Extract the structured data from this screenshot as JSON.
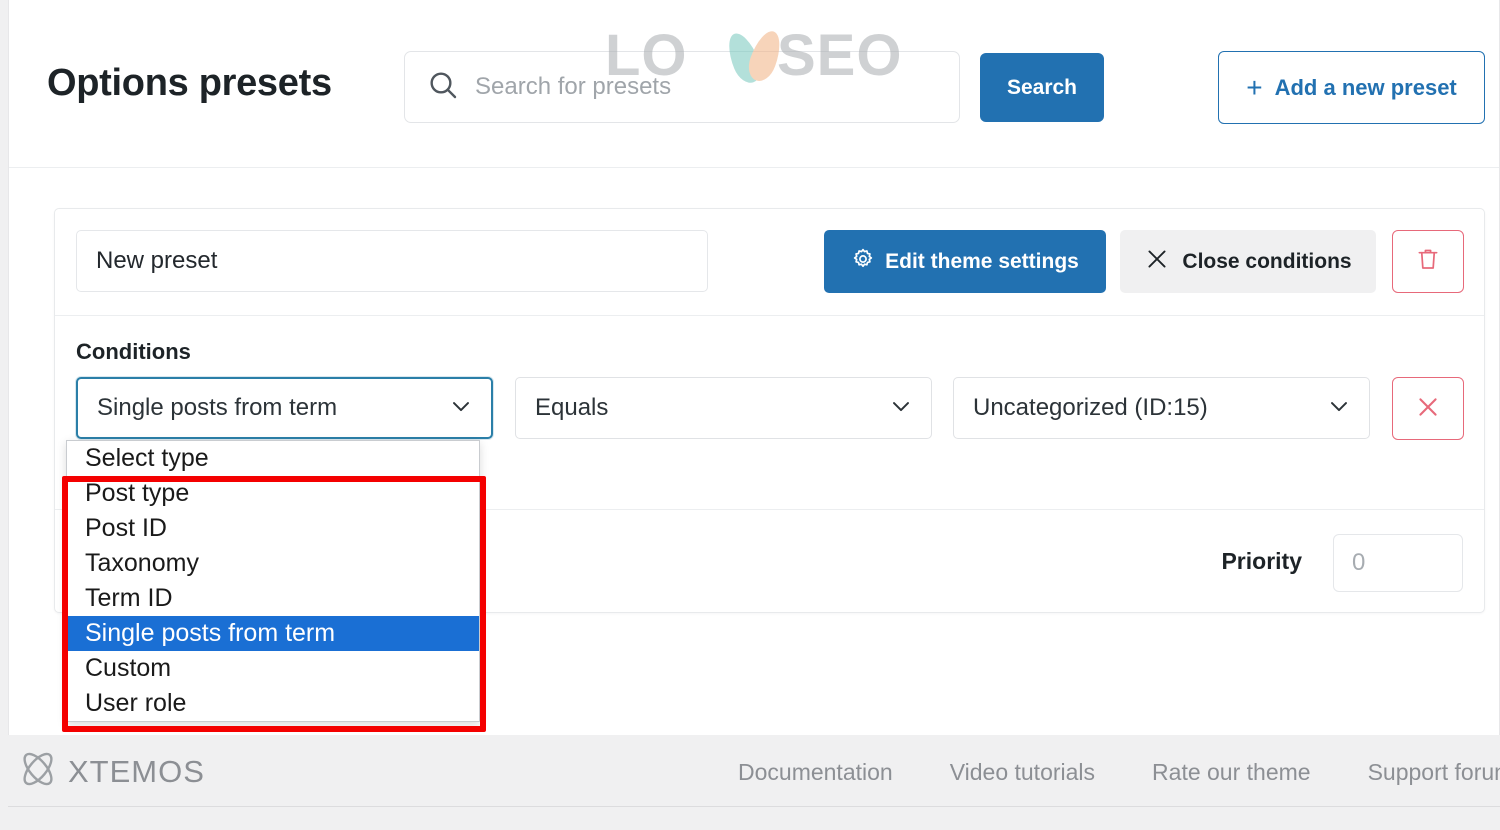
{
  "header": {
    "title": "Options presets",
    "search": {
      "placeholder": "Search for presets",
      "value": "",
      "icon": "search-icon"
    },
    "search_button": "Search",
    "add_preset_button": "Add a new preset",
    "add_preset_icon": "plus-icon"
  },
  "watermark": {
    "text": "LO SEO",
    "text_left": "LO",
    "text_right": "SEO"
  },
  "preset_card": {
    "name_value": "New preset",
    "edit_theme_button": "Edit theme settings",
    "edit_theme_icon": "gear-icon",
    "close_conditions_button": "Close conditions",
    "close_conditions_icon": "close-x-icon",
    "delete_icon": "trash-icon",
    "conditions_label": "Conditions",
    "condition_row": {
      "type_value": "Single posts from term",
      "operator_value": "Equals",
      "target_value": "Uncategorized (ID:15)",
      "remove_icon": "close-x-icon",
      "chevron_icon": "chevron-down-icon"
    },
    "priority_label": "Priority",
    "priority_value": "",
    "priority_placeholder": "0"
  },
  "dropdown": {
    "open": true,
    "selected_index": 5,
    "options": [
      "Select type",
      "Post type",
      "Post ID",
      "Taxonomy",
      "Term ID",
      "Single posts from term",
      "Custom",
      "User role"
    ]
  },
  "annotation": {
    "color": "#f40000",
    "kind": "highlight-rectangle"
  },
  "footer": {
    "brand": "XTEMOS",
    "brand_icon": "xtemos-logo-icon",
    "links": [
      "Documentation",
      "Video tutorials",
      "Rate our theme",
      "Support forum"
    ]
  },
  "colors": {
    "primary": "#2271b1",
    "danger": "#e7697a",
    "annotation": "#f40000",
    "select_highlight": "#1a6fd4",
    "muted": "#8c8f94"
  }
}
